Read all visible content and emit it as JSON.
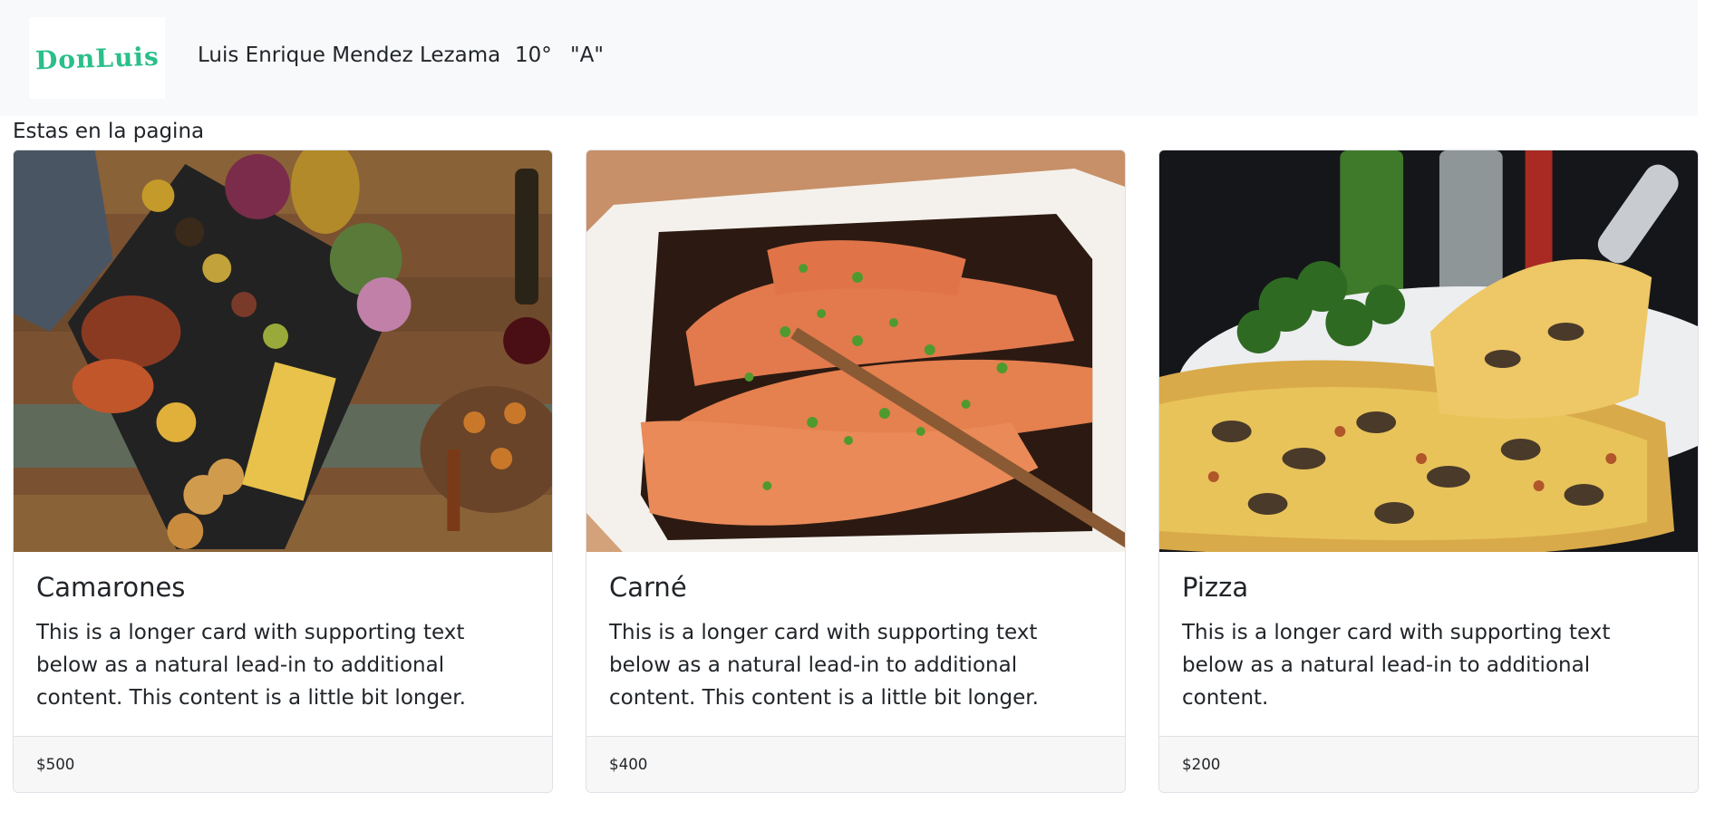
{
  "navbar": {
    "brand": "DonLuis",
    "student_name": "Luis Enrique Mendez Lezama",
    "grade": "10°",
    "group": "\"A\""
  },
  "page_label": "Estas en la pagina",
  "cards": [
    {
      "title": "Camarones",
      "text": "This is a longer card with supporting text below as a natural lead-in to additional content. This content is a little bit longer.",
      "price": "$500"
    },
    {
      "title": "Carné",
      "text": "This is a longer card with supporting text below as a natural lead-in to additional content. This content is a little bit longer.",
      "price": "$400"
    },
    {
      "title": "Pizza",
      "text": "This is a longer card with supporting text below as a natural lead-in to additional content.",
      "price": "$200"
    }
  ],
  "colors": {
    "brand": "#2bbf8a",
    "navbar_bg": "#f8f9fa",
    "footer_bg": "#f7f7f7"
  }
}
